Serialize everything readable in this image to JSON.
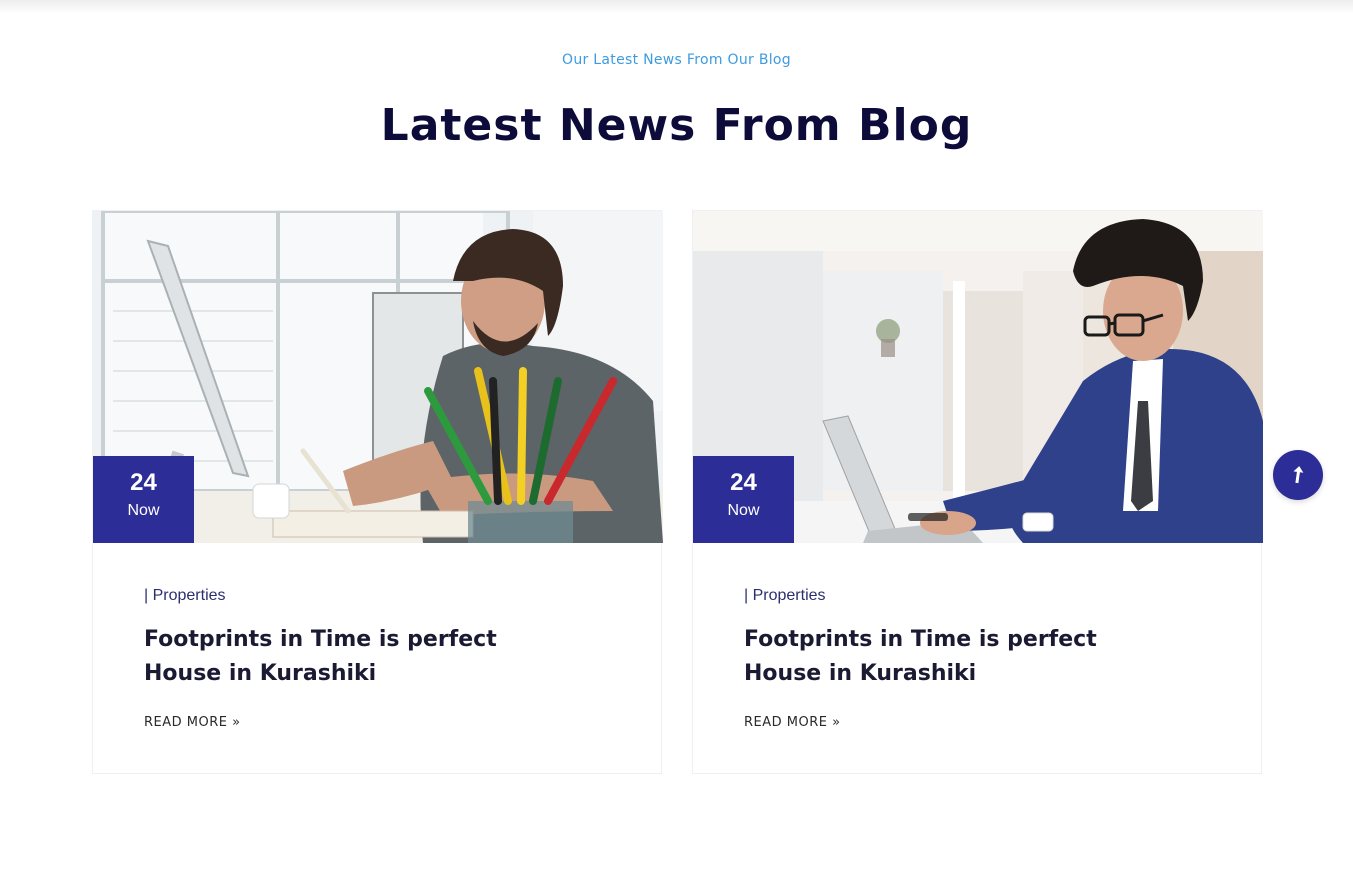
{
  "section": {
    "subtitle": "Our Latest News From Our Blog",
    "title": "Latest News From Blog"
  },
  "cards": [
    {
      "date_day": "24",
      "date_label": "Now",
      "category": "| Properties",
      "title": "Footprints in Time is perfect House in Kurashiki",
      "read_more": "READ MORE »",
      "image_icon": "photo-man-writing-at-desk"
    },
    {
      "date_day": "24",
      "date_label": "Now",
      "category": "| Properties",
      "title": "Footprints in Time is perfect House in Kurashiki",
      "read_more": "READ MORE »",
      "image_icon": "photo-man-typing-on-laptop"
    }
  ],
  "scroll_top": {
    "icon": "arrow-up-icon"
  },
  "colors": {
    "accent": "#2c2d96",
    "subtitle": "#3d9be0",
    "heading": "#0d0b3a"
  }
}
